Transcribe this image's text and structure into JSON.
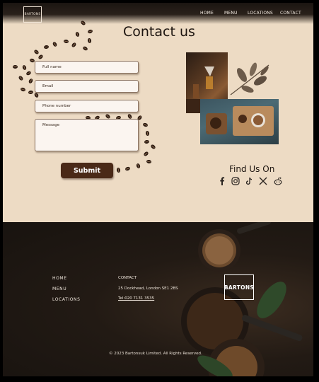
{
  "header": {
    "logo_text": "BARTONS",
    "nav": [
      "HOME",
      "MENU",
      "LOCATIONS",
      "CONTACT"
    ]
  },
  "main": {
    "title": "Contact us",
    "form": {
      "fields": [
        {
          "placeholder": "Full name"
        },
        {
          "placeholder": "Email"
        },
        {
          "placeholder": "Phone number"
        },
        {
          "placeholder": "Message"
        }
      ],
      "submit_label": "Submit"
    },
    "find_us": {
      "title": "Find Us On",
      "icons": [
        "facebook-icon",
        "instagram-icon",
        "tiktok-icon",
        "x-icon",
        "reddit-icon"
      ]
    }
  },
  "footer": {
    "nav": [
      "HOME",
      "MENU",
      "LOCATIONS"
    ],
    "contact": {
      "heading": "CONTACT",
      "address": "25 Dockhead, London SE1 2BS",
      "phone": "Tel:020 7131 3535"
    },
    "logo_text": "BARTONS",
    "copyright": "© 2023 Bartonsuk Limited. All Rights Reserved."
  },
  "colors": {
    "background": "#eddbc4",
    "accent": "#4a2917",
    "footer": "#1e1813"
  }
}
